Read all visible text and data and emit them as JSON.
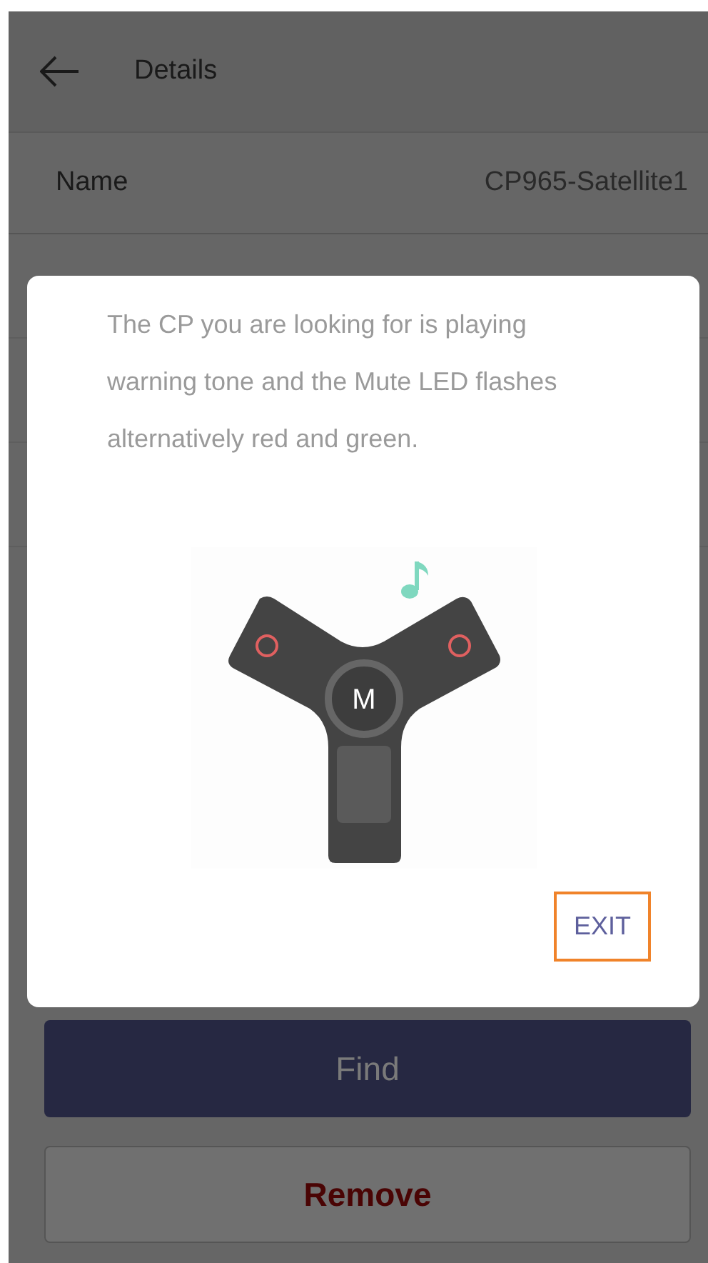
{
  "header": {
    "title": "Details"
  },
  "rows": [
    {
      "label": "Name",
      "value": "CP965-Satellite1"
    }
  ],
  "dialog": {
    "message": "The CP you are looking for is playing warning tone and the Mute LED flashes alternatively red and green.",
    "device_key_label": "M",
    "exit_button": {
      "label": "EXIT",
      "highlighted": true
    }
  },
  "buttons": [
    {
      "kind": "primary",
      "label": "Find"
    },
    {
      "kind": "danger",
      "label": "Remove"
    }
  ]
}
